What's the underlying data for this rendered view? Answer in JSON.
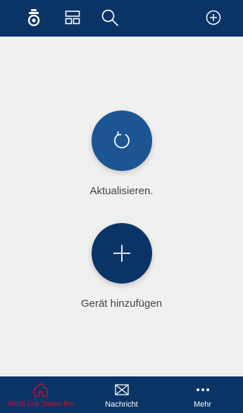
{
  "header": {
    "icons": [
      "camera-icon",
      "layout-icon",
      "search-icon",
      "add-circle-icon"
    ]
  },
  "main": {
    "refresh_label": "Aktualisieren.",
    "add_device_label": "Gerät hinzufügen"
  },
  "bottom_nav": {
    "items": [
      {
        "label": "ABUS Link Station Pro",
        "icon": "home-icon",
        "active": true
      },
      {
        "label": "Nachricht",
        "icon": "mail-icon",
        "active": false
      },
      {
        "label": "Mehr",
        "icon": "more-icon",
        "active": false
      }
    ]
  },
  "colors": {
    "header_bg": "#0b3466",
    "refresh_button": "#1b5594",
    "add_button": "#0b3466",
    "active_nav": "#c8102e",
    "background": "#f0f0f1"
  }
}
